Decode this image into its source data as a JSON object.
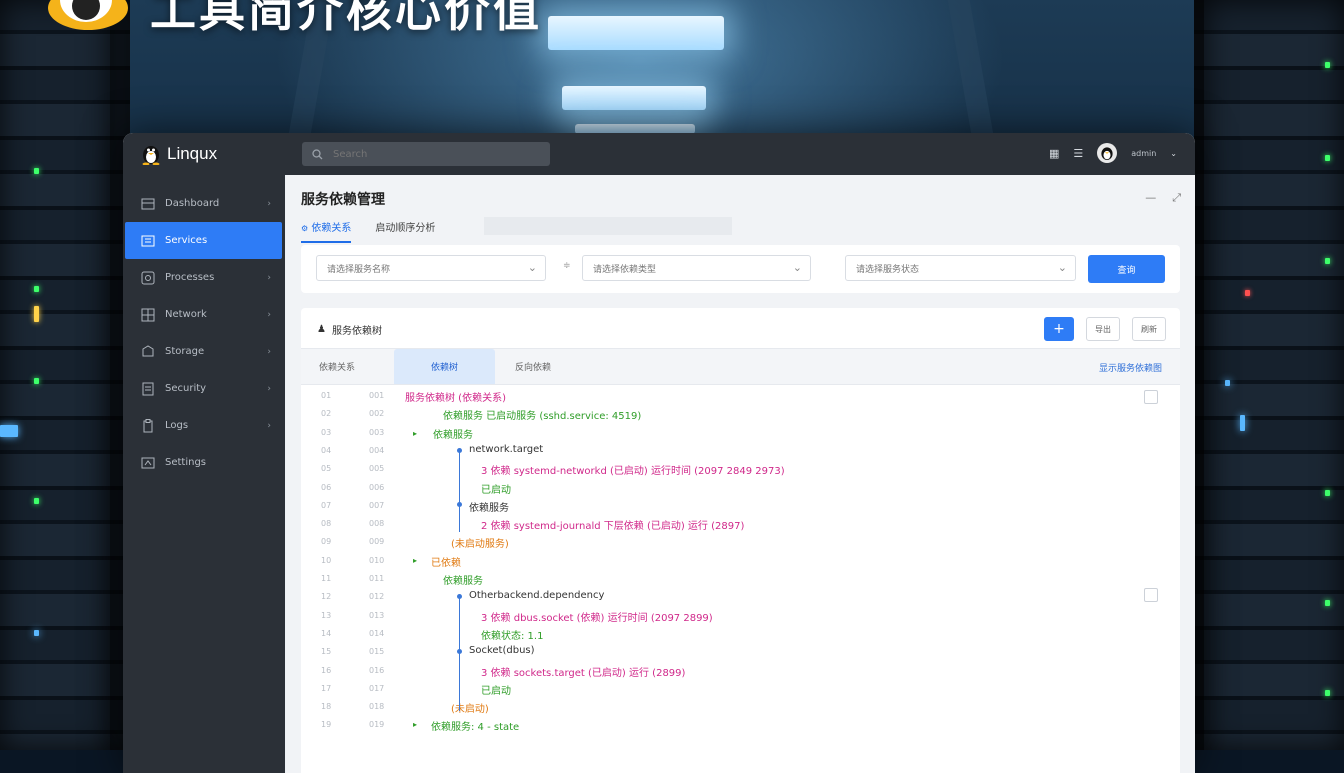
{
  "headline": "工具简介核心价值",
  "app": {
    "brand": "Linqux",
    "search_placeholder": "Search",
    "user_name": "admin"
  },
  "sidebar": {
    "items": [
      {
        "label": "Dashboard",
        "icon": "dashboard-icon",
        "active": false,
        "chevron": true
      },
      {
        "label": "Services",
        "icon": "services-icon",
        "active": true,
        "chevron": false
      },
      {
        "label": "Processes",
        "icon": "process-icon",
        "active": false,
        "chevron": true
      },
      {
        "label": "Network",
        "icon": "network-icon",
        "active": false,
        "chevron": true
      },
      {
        "label": "Storage",
        "icon": "storage-icon",
        "active": false,
        "chevron": true
      },
      {
        "label": "Security",
        "icon": "security-icon",
        "active": false,
        "chevron": true
      },
      {
        "label": "Logs",
        "icon": "logs-icon",
        "active": false,
        "chevron": true
      },
      {
        "label": "Settings",
        "icon": "settings-icon",
        "active": false,
        "chevron": false
      }
    ]
  },
  "page": {
    "title": "服务依赖管理",
    "tabs": [
      "依赖关系",
      "启动顺序分析"
    ]
  },
  "filters": {
    "select1": "请选择服务名称",
    "select2": "请选择依赖类型",
    "select3": "请选择服务状态",
    "query_button": "查询"
  },
  "list": {
    "title": "服务依赖树",
    "btn_add": "+",
    "btn_export": "导出",
    "btn_refresh": "刷新",
    "subtabs": [
      "依赖关系",
      "依赖树",
      "反向依赖"
    ],
    "right_link": "显示服务依赖图",
    "rows": [
      {
        "ln": "01",
        "ln2": "001",
        "text": "服务依赖树 (依赖关系)",
        "cls": "c-mag"
      },
      {
        "ln": "02",
        "ln2": "002",
        "text": "依赖服务 已启动服务 (sshd.service: 4519)",
        "cls": "c-grn"
      },
      {
        "ln": "03",
        "ln2": "003",
        "text": "依赖服务",
        "cls": "c-grn"
      },
      {
        "ln": "04",
        "ln2": "004",
        "text": "network.target",
        "cls": "c-dk"
      },
      {
        "ln": "05",
        "ln2": "005",
        "text": "3 依赖 systemd-networkd (已启动) 运行时间 (2097 2849 2973)",
        "cls": "c-mag"
      },
      {
        "ln": "06",
        "ln2": "006",
        "text": "已启动",
        "cls": "c-grn"
      },
      {
        "ln": "07",
        "ln2": "007",
        "text": "依赖服务",
        "cls": "c-dk"
      },
      {
        "ln": "08",
        "ln2": "008",
        "text": "2 依赖 systemd-journald 下层依赖 (已启动) 运行 (2897)",
        "cls": "c-mag"
      },
      {
        "ln": "09",
        "ln2": "009",
        "text": "(未启动服务)",
        "cls": "c-org"
      },
      {
        "ln": "10",
        "ln2": "010",
        "text": "已依赖",
        "cls": "c-org"
      },
      {
        "ln": "11",
        "ln2": "011",
        "text": "依赖服务",
        "cls": "c-grn"
      },
      {
        "ln": "12",
        "ln2": "012",
        "text": "Otherbackend.dependency",
        "cls": "c-dk"
      },
      {
        "ln": "13",
        "ln2": "013",
        "text": "3 依赖 dbus.socket (依赖) 运行时间 (2097 2899)",
        "cls": "c-mag"
      },
      {
        "ln": "14",
        "ln2": "014",
        "text": "依赖状态: 1.1",
        "cls": "c-grn"
      },
      {
        "ln": "15",
        "ln2": "015",
        "text": "Socket(dbus)",
        "cls": "c-dk"
      },
      {
        "ln": "16",
        "ln2": "016",
        "text": "3 依赖 sockets.target (已启动) 运行 (2899)",
        "cls": "c-mag"
      },
      {
        "ln": "17",
        "ln2": "017",
        "text": "已启动",
        "cls": "c-grn"
      },
      {
        "ln": "18",
        "ln2": "018",
        "text": "(未启动)",
        "cls": "c-org"
      },
      {
        "ln": "19",
        "ln2": "019",
        "text": "依赖服务: 4 - state",
        "cls": "c-grn"
      }
    ]
  },
  "colors": {
    "accent": "#2e7cf6",
    "topbar": "#2b3037",
    "tree_magenta": "#d0288a",
    "tree_green": "#2f9d28",
    "tree_orange": "#e07a12"
  }
}
